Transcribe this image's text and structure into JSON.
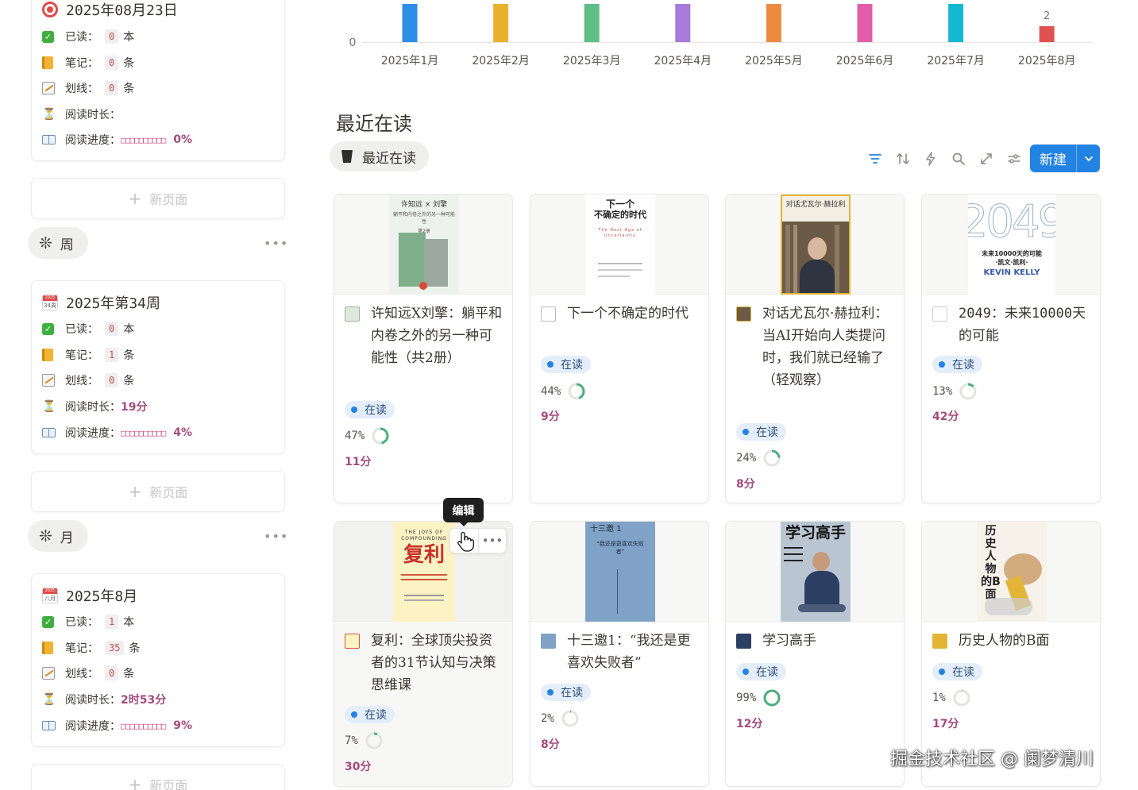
{
  "left": {
    "cards": [
      {
        "title": "2025年08月23日",
        "icon": "target-icon",
        "rows": {
          "read": {
            "label": "已读：",
            "value": "0",
            "unit": "本"
          },
          "notes": {
            "label": "笔记：",
            "value": "0",
            "unit": "条"
          },
          "marks": {
            "label": "划线：",
            "value": "0",
            "unit": "条"
          },
          "duration": {
            "label": "阅读时长：",
            "value": ""
          },
          "progress": {
            "label": "阅读进度：",
            "bar": "□□□□□□□□□□",
            "pct": "0%"
          }
        }
      },
      {
        "title": "2025年第34周",
        "icon": "calendar-icon",
        "cal_top": "2025",
        "cal_bottom": "34周",
        "rows": {
          "read": {
            "label": "已读：",
            "value": "0",
            "unit": "本"
          },
          "notes": {
            "label": "笔记：",
            "value": "1",
            "unit": "条"
          },
          "marks": {
            "label": "划线：",
            "value": "0",
            "unit": "条"
          },
          "duration": {
            "label": "阅读时长：",
            "value": "19分"
          },
          "progress": {
            "label": "阅读进度：",
            "bar": "□□□□□□□□□□",
            "pct": "4%"
          }
        }
      },
      {
        "title": "2025年8月",
        "icon": "calendar-icon",
        "cal_top": "2025",
        "cal_bottom": "八月",
        "rows": {
          "read": {
            "label": "已读：",
            "value": "1",
            "unit": "本"
          },
          "notes": {
            "label": "笔记：",
            "value": "35",
            "unit": "条"
          },
          "marks": {
            "label": "划线：",
            "value": "0",
            "unit": "条"
          },
          "duration": {
            "label": "阅读时长：",
            "value": "2时53分"
          },
          "progress": {
            "label": "阅读进度：",
            "bar": "□□□□□□□□□□",
            "pct": "9%"
          }
        }
      }
    ],
    "new_page_label": "新页面",
    "groups": {
      "week": "周",
      "month": "月"
    }
  },
  "chart_data": {
    "type": "bar",
    "categories": [
      "2025年1月",
      "2025年2月",
      "2025年3月",
      "2025年4月",
      "2025年5月",
      "2025年6月",
      "2025年7月",
      "2025年8月"
    ],
    "values": [
      0,
      0,
      0,
      0,
      0,
      0,
      0,
      2
    ],
    "colors": [
      "#2d8ee6",
      "#e8b22e",
      "#5fbf86",
      "#a77bd9",
      "#ee8a3f",
      "#e05ea8",
      "#15b8d3",
      "#e05252"
    ],
    "value_label": "2",
    "y_tick_label": "0"
  },
  "section": {
    "title": "最近在读",
    "view_tab": "最近在读",
    "new_button": "新建"
  },
  "toolbar_icons": [
    "filter-icon",
    "sort-icon",
    "lightning-icon",
    "search-icon",
    "expand-icon",
    "settings-icon"
  ],
  "accent": "#2383e2",
  "books": [
    {
      "title": "许知远X刘擎：躺平和内卷之外的另一种可能性（共2册）",
      "status": "在读",
      "progress": 47,
      "progress_label": "47%",
      "time": "11分"
    },
    {
      "title": "下一个不确定的时代",
      "status": "在读",
      "progress": 44,
      "progress_label": "44%",
      "time": "9分"
    },
    {
      "title": "对话尤瓦尔·赫拉利：当AI开始向人类提问时，我们就已经输了（轻观察）",
      "status": "在读",
      "progress": 24,
      "progress_label": "24%",
      "time": "8分"
    },
    {
      "title": "2049：未来10000天的可能",
      "status": "在读",
      "progress": 13,
      "progress_label": "13%",
      "time": "42分"
    },
    {
      "title": "复利：全球顶尖投资者的31节认知与决策思维课",
      "status": "在读",
      "progress": 7,
      "progress_label": "7%",
      "time": "30分"
    },
    {
      "title": "十三邀1：“我还是更喜欢失败者”",
      "status": "在读",
      "progress": 2,
      "progress_label": "2%",
      "time": "8分"
    },
    {
      "title": "学习高手",
      "status": "在读",
      "progress": 99,
      "progress_label": "99%",
      "time": "12分"
    },
    {
      "title": "历史人物的B面",
      "status": "在读",
      "progress": 1,
      "progress_label": "1%",
      "time": "17分"
    }
  ],
  "covers": {
    "b1": {
      "line1": "许知远 × 刘擎",
      "line2": "躺平和内卷之外的另一种可能性",
      "line3": "第2册"
    },
    "b2": {
      "line1": "下一个",
      "line2": "不确定的时代",
      "line3": "The Next Age of Uncertainty"
    },
    "b3": {
      "line1": "对话尤瓦尔·赫拉利"
    },
    "b4": {
      "line1": "2049",
      "line2": "未来10000天的可能",
      "line3": "·凯文·凯利·",
      "line4": "KEVIN KELLY"
    },
    "b5": {
      "line1": "THE JOYS OF COMPOUNDING",
      "line2": "复利"
    },
    "b6": {
      "line1": "十三邀 1",
      "line2": "“我还是更喜欢失败者”"
    },
    "b7": {
      "line1": "学习高手"
    },
    "b8": {
      "line1": "历史人物的B面"
    }
  },
  "tooltip": "编辑",
  "watermark": "掘金技术社区 @ 阑梦清川"
}
